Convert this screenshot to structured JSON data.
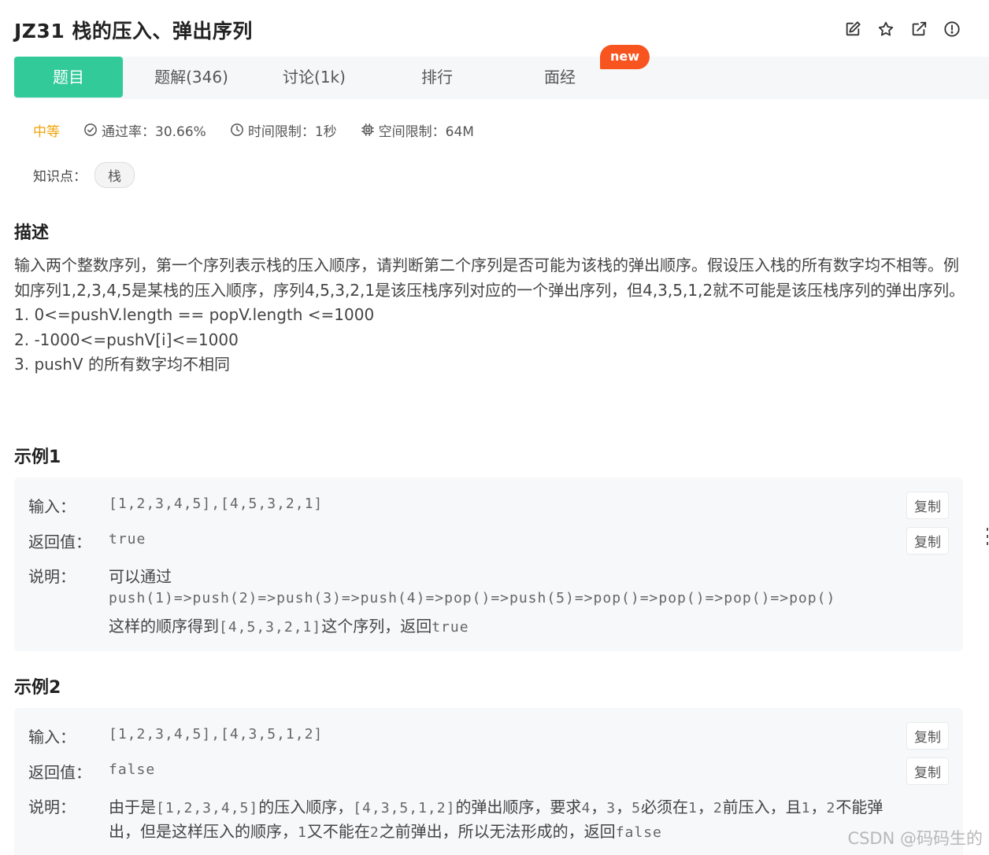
{
  "header": {
    "title": "JZ31  栈的压入、弹出序列"
  },
  "tabs": [
    {
      "label": "题目",
      "active": true
    },
    {
      "label": "题解(346)"
    },
    {
      "label": "讨论(1k)"
    },
    {
      "label": "排行"
    },
    {
      "label": "面经"
    }
  ],
  "badge": "new",
  "meta": {
    "difficulty": "中等",
    "pass_rate": "通过率：30.66%",
    "time_limit": "时间限制：1秒",
    "space_limit": "空间限制：64M"
  },
  "knowledge": {
    "label": "知识点：",
    "tag": "栈"
  },
  "description": {
    "heading": "描述",
    "text": "输入两个整数序列，第一个序列表示栈的压入顺序，请判断第二个序列是否可能为该栈的弹出顺序。假设压入栈的所有数字均不相等。例如序列1,2,3,4,5是某栈的压入顺序，序列4,5,3,2,1是该压栈序列对应的一个弹出序列，但4,3,5,1,2就不可能是该压栈序列的弹出序列。",
    "constraints": [
      "1. 0<=pushV.length == popV.length <=1000",
      "2. -1000<=pushV[i]<=1000",
      "3. pushV 的所有数字均不相同"
    ]
  },
  "examples": [
    {
      "heading": "示例1",
      "input_label": "输入：",
      "input": "[1,2,3,4,5],[4,5,3,2,1]",
      "return_label": "返回值：",
      "return": "true",
      "explain_label": "说明：",
      "explain_line1": "可以通过",
      "explain_line2": "push(1)=>push(2)=>push(3)=>push(4)=>pop()=>push(5)=>pop()=>pop()=>pop()=>pop()",
      "explain_line3_a": "这样的顺序得到",
      "explain_line3_b": "[4,5,3,2,1]",
      "explain_line3_c": "这个序列，返回",
      "explain_line3_d": "true",
      "copy": "复制"
    },
    {
      "heading": "示例2",
      "input_label": "输入：",
      "input": "[1,2,3,4,5],[4,3,5,1,2]",
      "return_label": "返回值：",
      "return": "false",
      "explain_label": "说明：",
      "l1a": "由于是",
      "l1b": "[1,2,3,4,5]",
      "l1c": "的压入顺序，",
      "l1d": "[4,3,5,1,2]",
      "l1e": "的弹出顺序，要求",
      "l1f": "4",
      "l1g": "，",
      "l1h": "3",
      "l1i": "，",
      "l1j": "5",
      "l1k": "必须在",
      "l1l": "1",
      "l1m": "，",
      "l1n": "2",
      "l1o": "前压入，且",
      "l1p": "1",
      "l1q": "，",
      "l1r": "2",
      "l1s": "不能弹",
      "l2a": "出，但是这样压入的顺序，",
      "l2b": "1",
      "l2c": "又不能在",
      "l2d": "2",
      "l2e": "之前弹出，所以无法形成的，返回",
      "l2f": "false",
      "copy": "复制"
    }
  ],
  "watermark": "CSDN @码码生的",
  "icons": {
    "edit": "edit-icon",
    "star": "star-icon",
    "share": "external-link-icon",
    "report": "alert-icon",
    "check": "check-circle-icon",
    "clock": "clock-icon",
    "chip": "chip-icon"
  },
  "colors": {
    "accent": "#32ca99",
    "difficulty": "#f0a30a",
    "badge": "#f8541f"
  }
}
